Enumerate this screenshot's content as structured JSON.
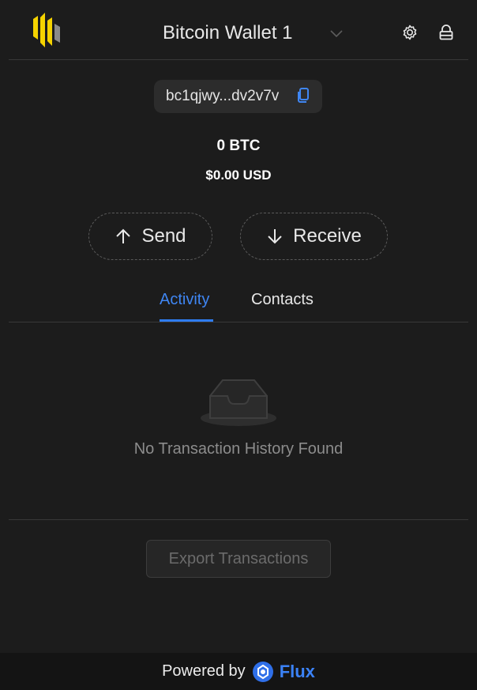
{
  "header": {
    "wallet_name": "Bitcoin Wallet 1",
    "logo_icon": "brand-logo-icon",
    "chevron_icon": "chevron-down-icon",
    "settings_icon": "gear-icon",
    "lock_icon": "lock-icon"
  },
  "address": {
    "short": "bc1qjwy...dv2v7v",
    "copy_icon": "copy-icon"
  },
  "balance": {
    "btc": "0 BTC",
    "usd": "$0.00 USD"
  },
  "actions": {
    "send_label": "Send",
    "receive_label": "Receive"
  },
  "tabs": {
    "activity": "Activity",
    "contacts": "Contacts",
    "active": "Activity"
  },
  "empty_state": {
    "icon": "inbox-icon",
    "message": "No Transaction History Found"
  },
  "export": {
    "label": "Export Transactions",
    "enabled": false
  },
  "footer": {
    "powered_by": "Powered by",
    "brand": "Flux"
  },
  "colors": {
    "background": "#1c1c1c",
    "accent": "#3f86f3",
    "logo_yellow": "#f5d300",
    "footer_bg": "#141414"
  }
}
